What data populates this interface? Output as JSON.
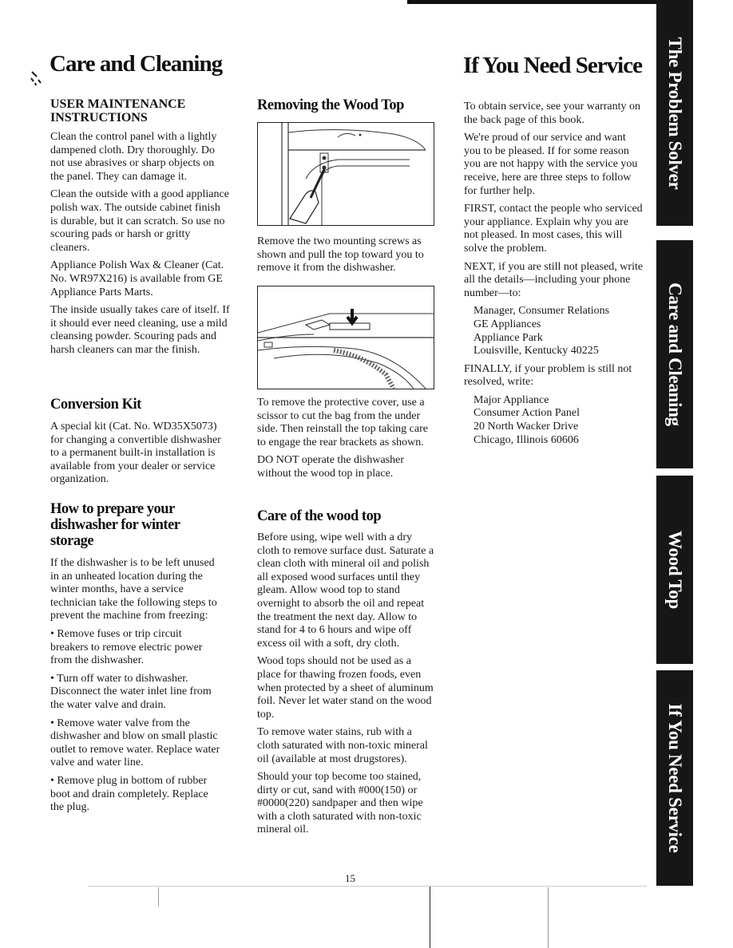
{
  "page": {
    "page_number": "15",
    "side_tabs": [
      {
        "label": "The Problem Solver"
      },
      {
        "label": "Care and Cleaning"
      },
      {
        "label": "Wood Top"
      },
      {
        "label": "If You Need Service"
      }
    ]
  },
  "left_column": {
    "title": "Care and Cleaning",
    "user_maintenance": {
      "heading": "USER MAINTENANCE INSTRUCTIONS",
      "paragraphs": [
        "Clean the control panel with a lightly dampened cloth. Dry thoroughly. Do not use abrasives or sharp objects on the panel. They can damage it.",
        "Clean the outside with a good appliance polish wax. The outside cabinet finish is durable, but it can scratch. So use no scouring pads or harsh or gritty cleaners.",
        "Appliance Polish Wax & Cleaner (Cat. No. WR97X216) is available from GE Appliance Parts Marts.",
        "The inside usually takes care of itself. If it should ever need cleaning, use a mild cleansing powder. Scouring pads and harsh cleaners can mar the finish."
      ]
    },
    "conversion_kit": {
      "heading": "Conversion Kit",
      "paragraphs": [
        "A special kit (Cat. No. WD35X5073) for changing a convertible dishwasher to a permanent built-in installation is available from your dealer or service organization."
      ]
    },
    "winter_storage": {
      "heading": "How to prepare your dishwasher for winter storage",
      "intro": "If the dishwasher is to be left unused in an unheated location during the winter months, have a service technician take the following steps to prevent the machine from freezing:",
      "steps": [
        "• Remove fuses or trip circuit breakers to remove electric power from the dishwasher.",
        "• Turn off water to dishwasher. Disconnect the water inlet line from the water valve and drain.",
        "• Remove water valve from the dishwasher and blow on small plastic outlet to remove water. Replace water valve and water line.",
        "• Remove plug in bottom of rubber boot and drain completely. Replace the plug."
      ]
    }
  },
  "middle_column": {
    "removing_wood_top": {
      "heading": "Removing the Wood Top",
      "figure1_caption": "Remove the two mounting screws as shown and pull the top toward you to remove it from the dishwasher.",
      "paragraphs": [
        "To remove the protective cover, use a scissor to cut the bag from the under side. Then reinstall the top taking care to engage the rear brackets as shown.",
        "DO NOT operate the dishwasher without the wood top in place."
      ]
    },
    "care_of_wood_top": {
      "heading": "Care of the wood top",
      "paragraphs": [
        "Before using, wipe well with a dry cloth to remove surface dust. Saturate a clean cloth with mineral oil and polish all exposed wood surfaces until they gleam. Allow wood top to stand overnight to absorb the oil and repeat the treatment the next day. Allow to stand for 4 to 6 hours and wipe off excess oil with a soft, dry cloth.",
        "Wood tops should not be used as a place for thawing frozen foods, even when protected by a sheet of aluminum foil. Never let water stand on the wood top.",
        "To remove water stains, rub with a cloth saturated with non-toxic mineral oil (available at most drugstores).",
        "Should your top become too stained, dirty or cut, sand with #000(150) or #0000(220) sandpaper and then wipe with a cloth saturated with non-toxic mineral oil."
      ]
    }
  },
  "right_column": {
    "title": "If You Need Service",
    "paragraphs": [
      "To obtain service, see your warranty on the back page of this book.",
      "We're proud of our service and want you to be pleased. If for some reason you are not happy with the service you receive, here are three steps to follow for further help.",
      "FIRST, contact the people who serviced your appliance. Explain why you are not pleased. In most cases, this will solve the problem.",
      "NEXT, if you are still not pleased, write all the details—including your phone number—to:"
    ],
    "address1": [
      "Manager, Consumer Relations",
      "GE Appliances",
      "Appliance Park",
      "Louisville, Kentucky 40225"
    ],
    "finally": "FINALLY, if your problem is still not resolved, write:",
    "address2": [
      "Major Appliance",
      "Consumer Action Panel",
      "20 North Wacker Drive",
      "Chicago, Illinois 60606"
    ]
  }
}
